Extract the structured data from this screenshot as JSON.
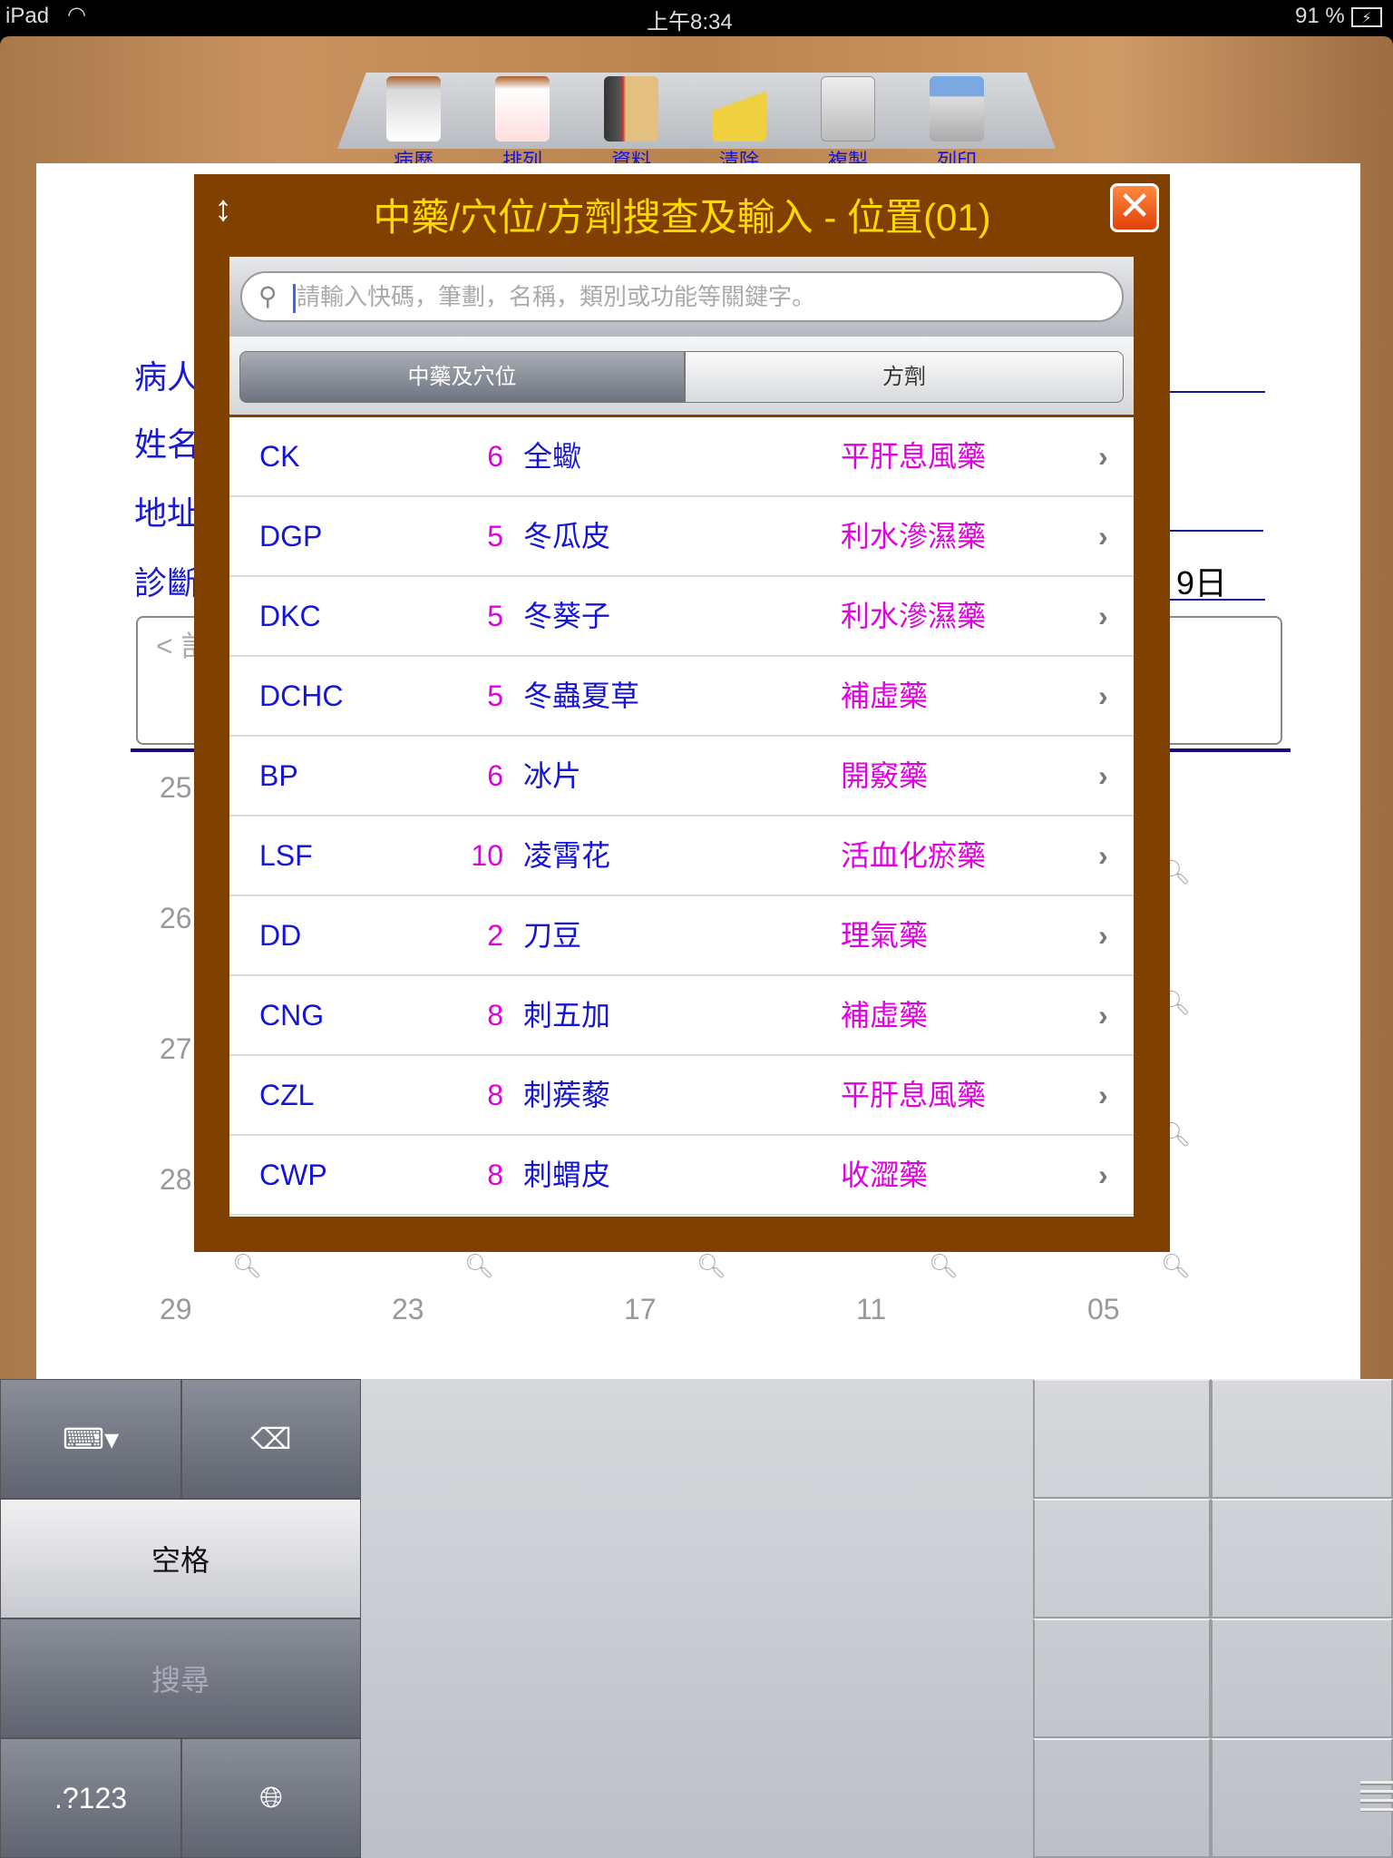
{
  "status": {
    "device": "iPad",
    "time": "上午8:34",
    "battery": "91 %"
  },
  "toolbar": [
    {
      "label": "病歷",
      "icon": "clipboard-search-icon"
    },
    {
      "label": "排列",
      "icon": "clipboard-sort-icon"
    },
    {
      "label": "資料",
      "icon": "books-icon"
    },
    {
      "label": "清除",
      "icon": "broom-icon"
    },
    {
      "label": "複製",
      "icon": "copy-icon"
    },
    {
      "label": "列印",
      "icon": "printer-icon"
    }
  ],
  "form": {
    "labels": [
      "病人",
      "姓名",
      "地址",
      "診斷"
    ],
    "date_fragment": "9日",
    "note_placeholder": "< 訁",
    "row_numbers": [
      "25",
      "26",
      "27",
      "28"
    ],
    "bottom_numbers": [
      "29",
      "23",
      "17",
      "11",
      "05"
    ]
  },
  "dialog": {
    "title": "中藥/穴位/方劑搜查及輸入 - 位置(01)",
    "search_placeholder": "請輸入快碼，筆劃，名稱，類別或功能等關鍵字。",
    "tabs": [
      "中藥及穴位",
      "方劑"
    ],
    "active_tab": 0,
    "rows": [
      {
        "code": "CK",
        "strokes": "6",
        "name": "全蠍",
        "category": "平肝息風藥"
      },
      {
        "code": "DGP",
        "strokes": "5",
        "name": "冬瓜皮",
        "category": "利水滲濕藥"
      },
      {
        "code": "DKC",
        "strokes": "5",
        "name": "冬葵子",
        "category": "利水滲濕藥"
      },
      {
        "code": "DCHC",
        "strokes": "5",
        "name": "冬蟲夏草",
        "category": "補虛藥"
      },
      {
        "code": "BP",
        "strokes": "6",
        "name": "冰片",
        "category": "開竅藥"
      },
      {
        "code": "LSF",
        "strokes": "10",
        "name": "凌霄花",
        "category": "活血化瘀藥"
      },
      {
        "code": "DD",
        "strokes": "2",
        "name": "刀豆",
        "category": "理氣藥"
      },
      {
        "code": "CNG",
        "strokes": "8",
        "name": "刺五加",
        "category": "補虛藥"
      },
      {
        "code": "CZL",
        "strokes": "8",
        "name": "刺蒺藜",
        "category": "平肝息風藥"
      },
      {
        "code": "CWP",
        "strokes": "8",
        "name": "刺蝟皮",
        "category": "收澀藥"
      }
    ]
  },
  "keyboard": {
    "space": "空格",
    "search": "搜尋",
    "numbers": ".?123"
  },
  "colors": {
    "dialog": "#804000",
    "title": "#ffd800",
    "code": "#1515d8",
    "category": "#e000e0"
  }
}
